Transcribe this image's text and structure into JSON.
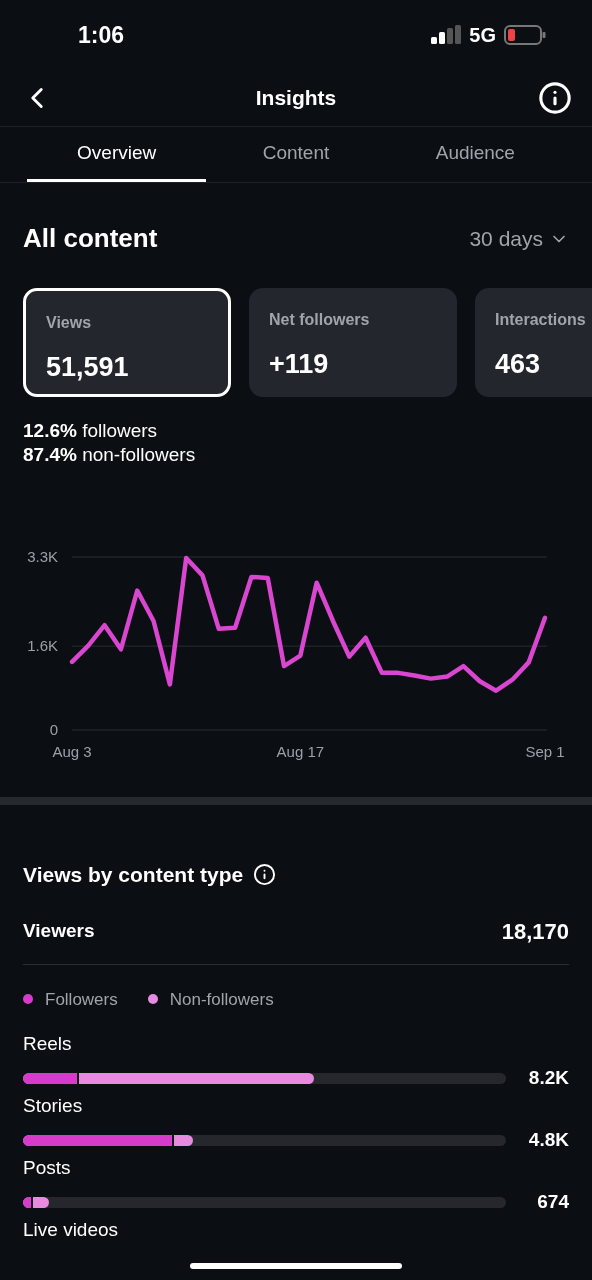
{
  "status_bar": {
    "time": "1:06",
    "network": "5G"
  },
  "header": {
    "title": "Insights"
  },
  "tabs": [
    {
      "label": "Overview",
      "selected": true
    },
    {
      "label": "Content",
      "selected": false
    },
    {
      "label": "Audience",
      "selected": false
    }
  ],
  "section": {
    "title": "All content",
    "period": "30 days"
  },
  "cards": [
    {
      "label": "Views",
      "value": "51,591",
      "selected": true
    },
    {
      "label": "Net followers",
      "value": "+119",
      "selected": false
    },
    {
      "label": "Interactions",
      "value": "463",
      "selected": false
    }
  ],
  "breakdown": [
    "**12.6%** followers",
    "**87.4%** non-followers"
  ],
  "chart_data": {
    "type": "line",
    "categories": [
      "Aug 3",
      null,
      null,
      null,
      null,
      null,
      null,
      null,
      null,
      null,
      null,
      null,
      null,
      null,
      "Aug 17",
      null,
      null,
      null,
      null,
      null,
      null,
      null,
      null,
      null,
      null,
      null,
      null,
      null,
      null,
      "Sep 1"
    ],
    "ylim": [
      0,
      3300
    ],
    "yticks": [
      0,
      {
        "value": 1600,
        "label": "1.6K"
      },
      {
        "value": 3300,
        "label": "3.3K"
      }
    ],
    "series": [
      {
        "color": "#d946d0",
        "values": [
          1300,
          1610,
          2000,
          1540,
          2660,
          2080,
          870,
          3280,
          2950,
          1930,
          1950,
          2920,
          2900,
          1220,
          1420,
          2810,
          2080,
          1400,
          1760,
          1090,
          1090,
          1040,
          980,
          1020,
          1220,
          930,
          750,
          960,
          1290,
          2140
        ]
      }
    ]
  },
  "content_type": {
    "title": "Views by content type",
    "total_label": "Viewers",
    "total": "18,170",
    "legend": [
      {
        "label": "Followers",
        "color": "#d63bcc"
      },
      {
        "label": "Non-followers",
        "color": "#e88ae0"
      }
    ],
    "rows": [
      {
        "label": "Reels",
        "value": "8.2K",
        "all_viewers": {
          "level": 0.602
        },
        "followers": {
          "level": 0.112
        }
      },
      {
        "label": "Stories",
        "value": "4.8K",
        "all_viewers": {
          "level": 0.353
        },
        "followers": {
          "level": 0.308
        }
      },
      {
        "label": "Posts",
        "value": "674",
        "all_viewers": {
          "level": 0.054
        },
        "followers": {
          "level": 0.017
        }
      },
      {
        "label": "Live videos"
      }
    ]
  }
}
